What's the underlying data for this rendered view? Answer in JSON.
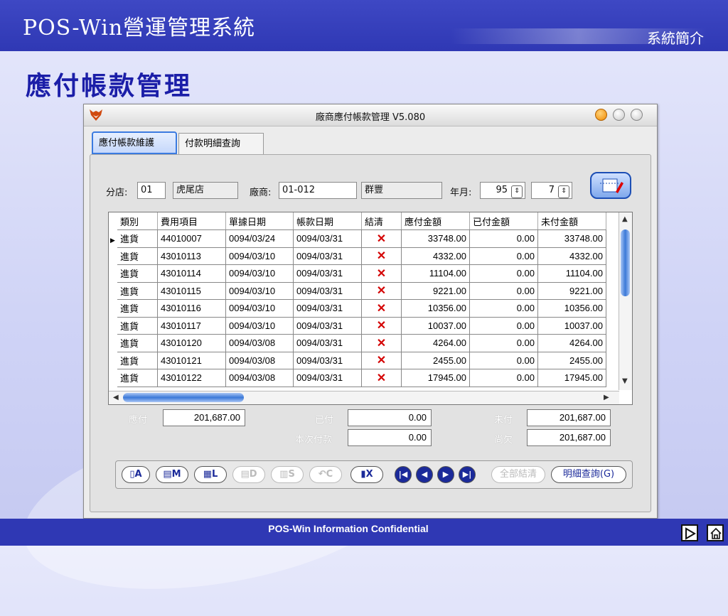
{
  "slide": {
    "title": "POS-Win營運管理系統",
    "subtitle": "系統簡介",
    "heading": "應付帳款管理",
    "footer": "POS-Win Information Confidential"
  },
  "window": {
    "title": "廠商應付帳款管理 V5.080"
  },
  "tabs": [
    "應付帳款維護",
    "付款明細查詢"
  ],
  "filters": {
    "branch_label": "分店:",
    "branch_code": "01",
    "branch_name": "虎尾店",
    "vendor_label": "廠商:",
    "vendor_code": "01-012",
    "vendor_name": "群豐",
    "ym_label": "年月:",
    "year": "95",
    "month": "7"
  },
  "table": {
    "headers": [
      "類別",
      "費用項目",
      "單據日期",
      "帳款日期",
      "結清",
      "應付金額",
      "已付金額",
      "未付金額"
    ],
    "rows": [
      [
        "進貨",
        "44010007",
        "0094/03/24",
        "0094/03/31",
        "✕",
        "33748.00",
        "0.00",
        "33748.00"
      ],
      [
        "進貨",
        "43010113",
        "0094/03/10",
        "0094/03/31",
        "✕",
        "4332.00",
        "0.00",
        "4332.00"
      ],
      [
        "進貨",
        "43010114",
        "0094/03/10",
        "0094/03/31",
        "✕",
        "11104.00",
        "0.00",
        "11104.00"
      ],
      [
        "進貨",
        "43010115",
        "0094/03/10",
        "0094/03/31",
        "✕",
        "9221.00",
        "0.00",
        "9221.00"
      ],
      [
        "進貨",
        "43010116",
        "0094/03/10",
        "0094/03/31",
        "✕",
        "10356.00",
        "0.00",
        "10356.00"
      ],
      [
        "進貨",
        "43010117",
        "0094/03/10",
        "0094/03/31",
        "✕",
        "10037.00",
        "0.00",
        "10037.00"
      ],
      [
        "進貨",
        "43010120",
        "0094/03/08",
        "0094/03/31",
        "✕",
        "4264.00",
        "0.00",
        "4264.00"
      ],
      [
        "進貨",
        "43010121",
        "0094/03/08",
        "0094/03/31",
        "✕",
        "2455.00",
        "0.00",
        "2455.00"
      ],
      [
        "進貨",
        "43010122",
        "0094/03/08",
        "0094/03/31",
        "✕",
        "17945.00",
        "0.00",
        "17945.00"
      ]
    ]
  },
  "summary": {
    "payable_label": "應付",
    "payable": "201,687.00",
    "paid_label": "已付",
    "paid": "0.00",
    "unpaid_label": "未付",
    "unpaid": "201,687.00",
    "this_payment_label": "本次付款",
    "this_payment": "0.00",
    "owed_label": "尚欠",
    "owed": "201,687.00"
  },
  "toolbar": {
    "add": "A",
    "modify": "M",
    "list": "L",
    "delete": "D",
    "save": "S",
    "undo": "C",
    "exit": "X",
    "settle_all": "全部結清",
    "detail_query": "明細查詢(G)"
  }
}
